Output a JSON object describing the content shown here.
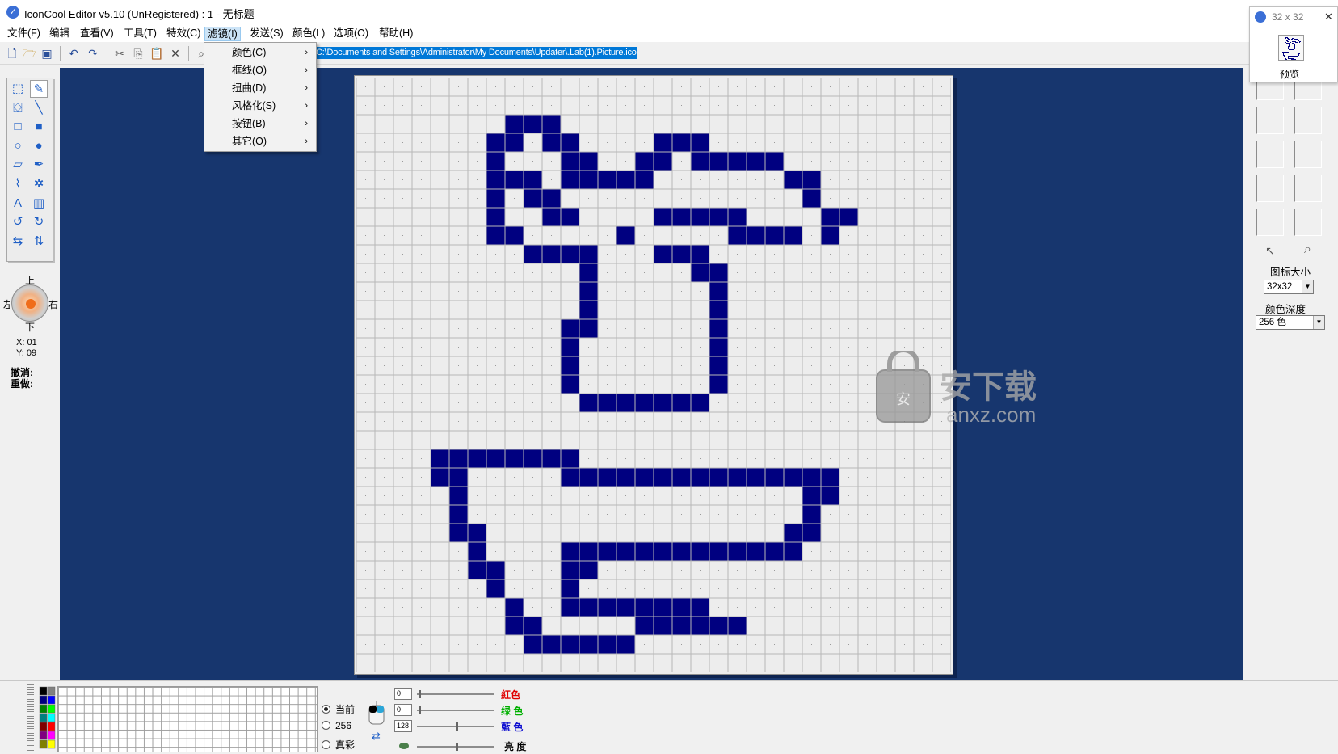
{
  "app": {
    "title": "IconCool Editor v5.10 (UnRegistered) : 1 - 无标题",
    "minimize_glyph": "—"
  },
  "menu": {
    "items": [
      "文件(F)",
      "编辑",
      "查看(V)",
      "工具(T)",
      "特效(C)",
      "滤镜(I)",
      "发送(S)",
      "颜色(L)",
      "选项(O)",
      "帮助(H)"
    ],
    "active_index": 5
  },
  "filter_menu": {
    "items": [
      "颜色(C)",
      "框线(O)",
      "扭曲(D)",
      "风格化(S)",
      "按钮(B)",
      "其它(O)"
    ],
    "submenu_glyph": "›"
  },
  "toolbar": {
    "file_path": "C:\\Documents and Settings\\Administrator\\My Documents\\Updater\\.Lab(1).Picture.ico",
    "buttons": [
      "new-icon",
      "open-icon",
      "save-icon",
      "undo-icon",
      "redo-icon",
      "cut-icon",
      "copy-icon",
      "paste-icon",
      "delete-icon",
      "zoom-icon"
    ],
    "glyphs": {
      "new": "🗋",
      "open": "🗁",
      "save": "▣",
      "undo": "↶",
      "redo": "↷",
      "cut": "✂",
      "copy": "⎘",
      "paste": "📋",
      "delete": "✕",
      "zoom": "⌕"
    }
  },
  "tools": {
    "items": [
      {
        "name": "select-rect-icon",
        "glyph": "⬚"
      },
      {
        "name": "pencil-icon",
        "glyph": "✎"
      },
      {
        "name": "fill-bucket-icon",
        "glyph": "⛋"
      },
      {
        "name": "line-icon",
        "glyph": "╲"
      },
      {
        "name": "rect-outline-icon",
        "glyph": "□"
      },
      {
        "name": "rect-filled-icon",
        "glyph": "■"
      },
      {
        "name": "ellipse-outline-icon",
        "glyph": "○"
      },
      {
        "name": "ellipse-filled-icon",
        "glyph": "●"
      },
      {
        "name": "eraser-icon",
        "glyph": "▱"
      },
      {
        "name": "color-picker-icon",
        "glyph": "✒"
      },
      {
        "name": "brush-icon",
        "glyph": "⌇"
      },
      {
        "name": "spray-icon",
        "glyph": "✲"
      },
      {
        "name": "text-icon",
        "glyph": "A"
      },
      {
        "name": "gradient-icon",
        "glyph": "▥"
      },
      {
        "name": "rotate-left-icon",
        "glyph": "↺"
      },
      {
        "name": "rotate-right-icon",
        "glyph": "↻"
      },
      {
        "name": "flip-horizontal-icon",
        "glyph": "⇆"
      },
      {
        "name": "flip-vertical-icon",
        "glyph": "⇅"
      }
    ],
    "selected_index": 1
  },
  "nav": {
    "up": "上",
    "down": "下",
    "left": "左",
    "right": "右"
  },
  "status": {
    "x": "X: 01",
    "y": "Y: 09",
    "undo": "撤消:",
    "redo": "重做:"
  },
  "canvas": {
    "grid_size": 32,
    "pixel_color": "#000080",
    "grid_color": "#b8b8b8",
    "background": "#ededed",
    "rows": [
      "................................",
      "................................",
      "........XXX.....................",
      ".......XX.XX....XXX.............",
      ".......X...XX..XX.XXXXX.........",
      ".......XXX.XXXXX.......XX........",
      ".......X.XX.............X.......",
      ".......X..XX....XXXXX....XX......",
      ".......XX.....X.....XXXX.X......",
      ".........XXXX...XXX.............",
      "............X.....XX............",
      "............X......X............",
      "............X......X............",
      "...........XX......X............",
      "...........X.......X............",
      "...........X.......X............",
      "...........X.......X............",
      "............XXXXXXX.............",
      "................................",
      "................................",
      "....XXXXXXXX....................",
      "....XX.....XXXXXXXXXXXXXXX......",
      ".....X..................XX......",
      ".....X..................X.......",
      ".....XX................XX.......",
      "......X....XXXXXXXXXXXXX........",
      "......XX...XX...................",
      ".......X...X....................",
      "........X..XXXXXXXX.............",
      "........XX.....XXXXXX...........",
      ".........XXXXXX.................",
      "................................"
    ]
  },
  "watermark": {
    "cn": "安下载",
    "en": "anxz.com"
  },
  "preview": {
    "title": "32 x 32",
    "label": "预览",
    "close_glyph": "✕"
  },
  "right_panel": {
    "icon_size_label": "图标大小",
    "icon_size_value": "32x32",
    "color_depth_label": "颜色深度",
    "color_depth_value": "256 色",
    "dropdown_glyph": "▼",
    "bottom_icons": {
      "pointer": "↖",
      "zoom": "⌕"
    }
  },
  "palette": {
    "swatches": [
      "#000000",
      "#808080",
      "#000080",
      "#0000ff",
      "#008000",
      "#00ff00",
      "#008080",
      "#00ffff",
      "#800000",
      "#ff0000",
      "#800080",
      "#ff00ff",
      "#808000",
      "#ffff00"
    ],
    "current_fg": "#000000",
    "current_bg": "#000080"
  },
  "color_mode": {
    "current": "当前",
    "c256": "256",
    "truecolor": "真彩"
  },
  "channels": {
    "red": {
      "label": "紅色",
      "value": "0",
      "color": "#e00000"
    },
    "green": {
      "label": "绿 色",
      "value": "0",
      "color": "#00b000"
    },
    "blue": {
      "label": "藍 色",
      "value": "128",
      "color": "#1010d0"
    },
    "brightness": {
      "label": "亮   度"
    },
    "red_frac": 0.02,
    "green_frac": 0.02,
    "blue_frac": 0.5,
    "bright_frac": 0.5
  },
  "swap_glyph": "⇄"
}
